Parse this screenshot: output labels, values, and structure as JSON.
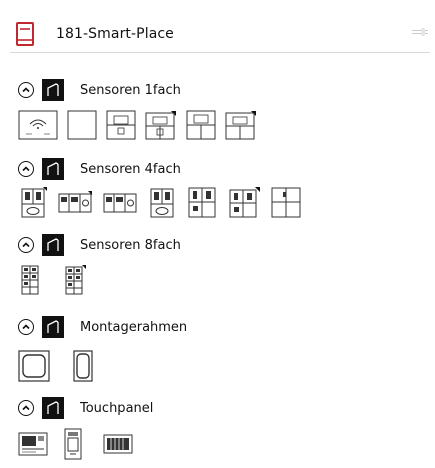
{
  "header": {
    "icon": "book-icon",
    "title": "181-Smart-Place",
    "right_icon": "grip-icon",
    "accent_color": "#c0282f"
  },
  "sections": [
    {
      "label": "Sensoren 1fach",
      "devices": [
        "wireless-sensor",
        "blank-panel",
        "panel-window-1",
        "panel-window-2",
        "panel-window-3",
        "panel-window-4"
      ]
    },
    {
      "label": "Sensoren 4fach",
      "devices": [
        "sensor-4-a",
        "sensor-4-b",
        "sensor-4-c",
        "sensor-4-d",
        "sensor-4-e",
        "sensor-4-f",
        "sensor-4-g"
      ]
    },
    {
      "label": "Sensoren 8fach",
      "devices": [
        "sensor-8-a",
        "sensor-8-b"
      ]
    },
    {
      "label": "Montagerahmen",
      "devices": [
        "frame-square",
        "frame-tall"
      ]
    },
    {
      "label": "Touchpanel",
      "devices": [
        "touchpanel-a",
        "touchpanel-b",
        "touchpanel-c"
      ]
    }
  ]
}
